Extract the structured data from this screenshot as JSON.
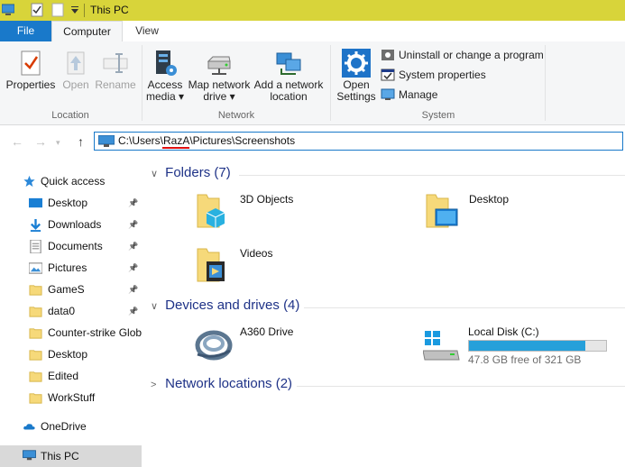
{
  "window": {
    "title": "This PC"
  },
  "tabs": {
    "file": "File",
    "computer": "Computer",
    "view": "View"
  },
  "ribbon": {
    "location": {
      "label": "Location",
      "properties": "Properties",
      "open": "Open",
      "rename": "Rename"
    },
    "network": {
      "label": "Network",
      "access_media_1": "Access",
      "access_media_2": "media",
      "map_drive_1": "Map network",
      "map_drive_2": "drive",
      "add_location_1": "Add a network",
      "add_location_2": "location"
    },
    "system": {
      "label": "System",
      "open_settings_1": "Open",
      "open_settings_2": "Settings",
      "uninstall": "Uninstall or change a program",
      "system_properties": "System properties",
      "manage": "Manage"
    }
  },
  "address": {
    "path": "C:\\Users\\RazA\\Pictures\\Screenshots"
  },
  "navpane": {
    "quick_access": "Quick access",
    "items": [
      {
        "label": "Desktop",
        "pinned": true
      },
      {
        "label": "Downloads",
        "pinned": true
      },
      {
        "label": "Documents",
        "pinned": true
      },
      {
        "label": "Pictures",
        "pinned": true
      },
      {
        "label": "GameS",
        "pinned": true
      },
      {
        "label": "data0",
        "pinned": true
      },
      {
        "label": "Counter-strike  Glob"
      },
      {
        "label": "Desktop"
      },
      {
        "label": "Edited"
      },
      {
        "label": "WorkStuff"
      }
    ],
    "onedrive": "OneDrive",
    "this_pc": "This PC"
  },
  "content": {
    "folders_header": "Folders (7)",
    "folders": [
      {
        "label": "3D Objects"
      },
      {
        "label": "Desktop"
      },
      {
        "label": "Videos"
      }
    ],
    "devices_header": "Devices and drives (4)",
    "devices": {
      "a360": "A360 Drive",
      "local_disk": {
        "label": "Local Disk (C:)",
        "free_text": "47.8 GB free of 321 GB",
        "used_fraction": 0.851
      }
    },
    "network_header": "Network locations (2)"
  },
  "colors": {
    "titlebar": "#d8d43a",
    "accent": "#1979ca",
    "disk_fill": "#26a0da"
  }
}
